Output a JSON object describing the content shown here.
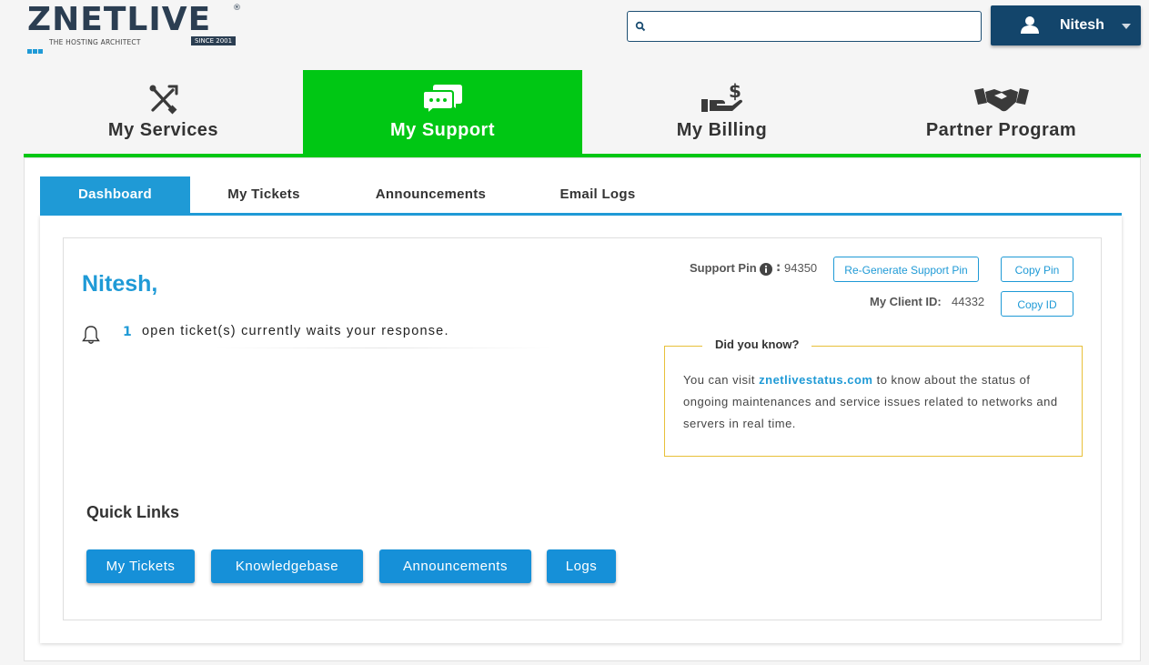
{
  "header": {
    "logo": {
      "text_main": "ZNETLIVE",
      "tagline": "THE HOSTING ARCHITECT",
      "since": "SINCE 2001",
      "registered": "®"
    },
    "search": {
      "placeholder": "",
      "value": ""
    },
    "user": {
      "name": "Nitesh"
    }
  },
  "main_tabs": [
    {
      "label": "My Services",
      "icon": "tools-icon",
      "active": false
    },
    {
      "label": "My Support",
      "icon": "chat-bubbles-icon",
      "active": true
    },
    {
      "label": "My Billing",
      "icon": "hand-dollar-icon",
      "active": false
    },
    {
      "label": "Partner Program",
      "icon": "handshake-icon",
      "active": false
    }
  ],
  "sub_tabs": [
    {
      "label": "Dashboard",
      "active": true
    },
    {
      "label": "My Tickets",
      "active": false
    },
    {
      "label": "Announcements",
      "active": false
    },
    {
      "label": "Email Logs",
      "active": false
    }
  ],
  "dashboard": {
    "greeting": "Nitesh,",
    "open_ticket_count": "1",
    "open_ticket_message": "open ticket(s) currently waits your response.",
    "support_pin_label": "Support Pin",
    "support_pin_value": "94350",
    "regenerate_pin_label": "Re-Generate Support Pin",
    "copy_pin_label": "Copy Pin",
    "client_id_label": "My Client ID:",
    "client_id_value": "44332",
    "copy_id_label": "Copy ID",
    "did_you_know": {
      "title": "Did you know?",
      "text_before": "You can visit",
      "link": "znetlivestatus.com",
      "text_after": "to know about the status of ongoing maintenances and service issues related to networks and servers in real time."
    },
    "quick_links_title": "Quick Links",
    "quick_links": [
      "My Tickets",
      "Knowledgebase",
      "Announcements",
      "Logs"
    ]
  },
  "colors": {
    "accent_blue": "#1f9ad6",
    "active_green": "#00c714",
    "user_button": "#13456b",
    "notice_border": "#e8c039",
    "quick_link_button": "#1690d8"
  }
}
